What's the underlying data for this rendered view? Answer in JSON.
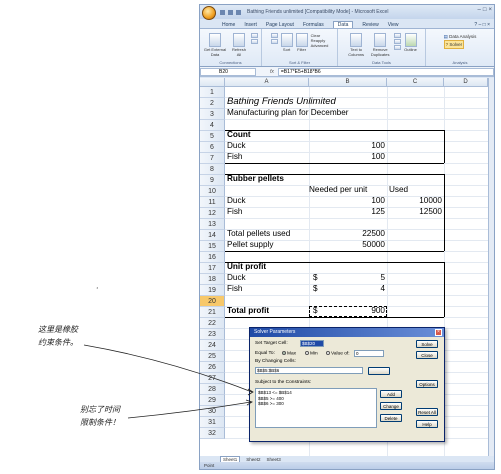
{
  "window": {
    "title": "Bathing Friends unlimited  [Compatibility Mode] - Microsoft Excel",
    "controls": [
      "–",
      "□",
      "×"
    ]
  },
  "ribbon": {
    "tabs": [
      "Home",
      "Insert",
      "Page Layout",
      "Formulas",
      "Data",
      "Review",
      "View"
    ],
    "active_tab": "Data",
    "buttons": {
      "get_external": "Get External Data",
      "refresh": "Refresh All",
      "sort": "Sort",
      "filter": "Filter",
      "clear": "Clear",
      "reapply": "Reapply",
      "advanced": "Advanced",
      "text_to_columns": "Text to Columns",
      "remove_duplicates": "Remove Duplicates",
      "outline": "Outline",
      "data_analysis": "Data Analysis",
      "solver": "Solver"
    },
    "groups": [
      "Connections",
      "Sort & Filter",
      "Data Tools",
      "Analysis"
    ]
  },
  "formula_bar": {
    "name_box": "B20",
    "fx": "fx",
    "formula": "=B17*E5+B18*B6"
  },
  "columns": [
    "A",
    "B",
    "C",
    "D"
  ],
  "rows": [
    "1",
    "2",
    "3",
    "4",
    "5",
    "6",
    "7",
    "8",
    "9",
    "10",
    "11",
    "12",
    "13",
    "14",
    "15",
    "16",
    "17",
    "18",
    "19",
    "20",
    "21",
    "22",
    "23",
    "24",
    "25",
    "26",
    "27",
    "28",
    "29",
    "30",
    "31",
    "32"
  ],
  "cells": {
    "a1": "Bathing Friends Unlimited",
    "a2": "Manufacturing plan for December",
    "a4": "Count",
    "a5": "Duck",
    "b5": "100",
    "a6": "Fish",
    "b6": "100",
    "a8": "Rubber pellets",
    "b9": "Needed per unit",
    "c9": "Used",
    "a10": "Duck",
    "b10": "100",
    "c10": "10000",
    "a11": "Fish",
    "b11": "125",
    "c11": "12500",
    "a13": "Total pellets used",
    "b13": "22500",
    "a14": "Pellet supply",
    "b14": "50000",
    "a16": "Unit profit",
    "a17": "Duck",
    "b17_cur": "$",
    "b17": "5",
    "a18": "Fish",
    "b18_cur": "$",
    "b18": "4",
    "a20": "Total profit",
    "b20_cur": "$",
    "b20": "900"
  },
  "solver": {
    "title": "Solver Parameters",
    "set_target_label": "Set Target Cell:",
    "target_value": "$B$20",
    "equal_to_label": "Equal To:",
    "max": "Max",
    "min": "Min",
    "value_of": "Value of:",
    "value_input": "0",
    "changing_label": "By Changing Cells:",
    "changing_value": "$B$5:$B$6",
    "guess": "Guess",
    "subject_label": "Subject to the Constraints:",
    "constraints": [
      "$B$13 <= $B$14",
      "$B$5 >= 400",
      "$B$6 >= 300"
    ],
    "buttons": {
      "solve": "Solve",
      "close": "Close",
      "options": "Options",
      "add": "Add",
      "change": "Change",
      "delete": "Delete",
      "reset_all": "Reset All",
      "help": "Help"
    }
  },
  "sheet_tabs": [
    "Sheet1",
    "Sheet2",
    "Sheet3"
  ],
  "status": "Point",
  "annotations": {
    "note1_line1": "这里是橡胶",
    "note1_line2": "约束条件。",
    "note2_line1": "别忘了时间",
    "note2_line2": "限制条件！",
    "dot": "·"
  }
}
